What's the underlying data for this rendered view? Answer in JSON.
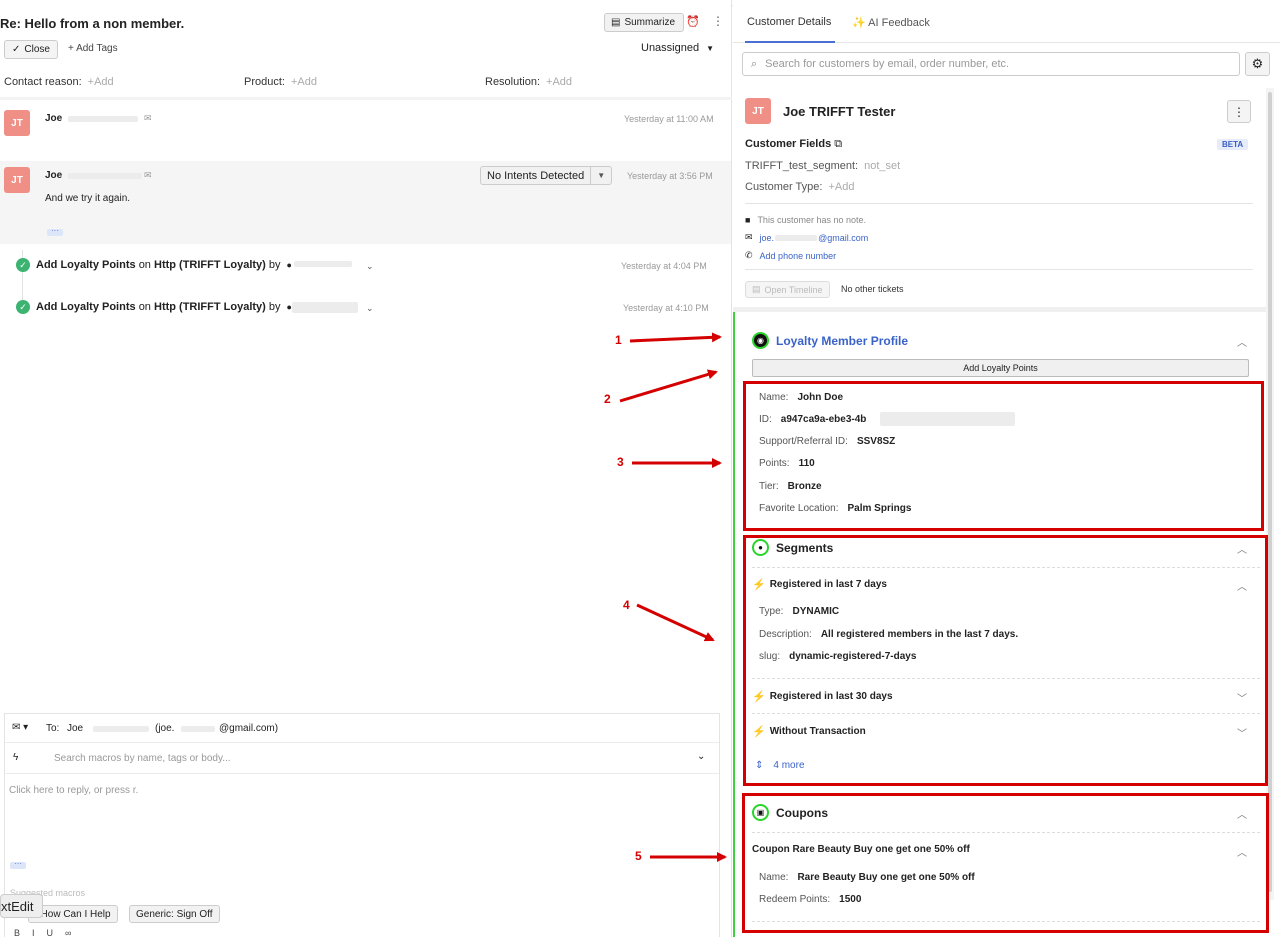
{
  "ticket": {
    "subject": "Re: Hello from a non member.",
    "summarize_label": "Summarize",
    "close_label": "Close",
    "add_tags_label": "Add Tags",
    "assignee": "Unassigned",
    "fields": [
      {
        "label": "Contact reason:",
        "placeholder": "+Add"
      },
      {
        "label": "Product:",
        "placeholder": "+Add"
      },
      {
        "label": "Resolution:",
        "placeholder": "+Add"
      }
    ]
  },
  "messages": [
    {
      "initials": "JT",
      "sender": "Joe",
      "time": "Yesterday at 11:00 AM",
      "body": ""
    },
    {
      "initials": "JT",
      "sender": "Joe",
      "time": "Yesterday at 3:56 PM",
      "body": "And we try it again.",
      "intent": "No Intents Detected"
    }
  ],
  "events": [
    {
      "action": "Add Loyalty Points",
      "on": "on",
      "target": "Http (TRIFFT Loyalty)",
      "by": "by",
      "time": "Yesterday at 4:04 PM"
    },
    {
      "action": "Add Loyalty Points",
      "on": "on",
      "target": "Http (TRIFFT Loyalty)",
      "by": "by",
      "time": "Yesterday at 4:10 PM"
    }
  ],
  "composer": {
    "to_label": "To:",
    "to_name": "Joe",
    "to_email_prefix": "(joe.",
    "to_email_suffix": "@gmail.com)",
    "macro_placeholder": "Search macros by name, tags or body...",
    "reply_placeholder": "Click here to reply, or press r.",
    "suggested_label": "Suggested macros",
    "macros": [
      ": How Can I Help",
      "Generic: Sign Off"
    ],
    "tooltip": "xtEdit"
  },
  "panel": {
    "tabs": [
      "Customer Details",
      "AI Feedback"
    ],
    "search_placeholder": "Search for customers by email, order number, etc.",
    "customer_initials": "JT",
    "customer_name": "Joe TRIFFT Tester",
    "fields_title": "Customer Fields",
    "beta_badge": "BETA",
    "segment_label": "TRIFFT_test_segment:",
    "segment_value": "not_set",
    "type_label": "Customer Type:",
    "type_value": "+Add",
    "note": "This customer has no note.",
    "email_prefix": "joe.",
    "email_suffix": "@gmail.com",
    "phone": "Add phone number",
    "timeline_btn": "Open Timeline",
    "other_tickets": "No other tickets"
  },
  "loyalty": {
    "title": "Loyalty Member Profile",
    "add_points": "Add Loyalty Points",
    "fields": [
      {
        "label": "Name:",
        "value": "John Doe"
      },
      {
        "label": "ID:",
        "value": "a947ca9a-ebe3-4b"
      },
      {
        "label": "Support/Referral ID:",
        "value": "SSV8SZ"
      },
      {
        "label": "Points:",
        "value": "110"
      },
      {
        "label": "Tier:",
        "value": "Bronze"
      },
      {
        "label": "Favorite Location:",
        "value": "Palm Springs"
      }
    ]
  },
  "segments": {
    "title": "Segments",
    "items": [
      {
        "name": "Registered in last 7 days",
        "expanded": true,
        "details": [
          {
            "label": "Type:",
            "value": "DYNAMIC"
          },
          {
            "label": "Description:",
            "value": "All registered members in the last 7 days."
          },
          {
            "label": "slug:",
            "value": "dynamic-registered-7-days"
          }
        ]
      },
      {
        "name": "Registered in last 30 days",
        "expanded": false
      },
      {
        "name": "Without Transaction",
        "expanded": false
      }
    ],
    "more": "4 more"
  },
  "coupons": {
    "title": "Coupons",
    "item_title": "Coupon Rare Beauty Buy one get one 50% off",
    "fields": [
      {
        "label": "Name:",
        "value": "Rare Beauty Buy one get one 50% off"
      },
      {
        "label": "Redeem Points:",
        "value": "1500"
      }
    ]
  },
  "annotations": [
    "1",
    "2",
    "3",
    "4",
    "5"
  ],
  "colors": {
    "annotation_red": "#d40000",
    "avatar": "#ef8f85",
    "accent_blue": "#3a63c8",
    "green": "#3fd13f"
  }
}
